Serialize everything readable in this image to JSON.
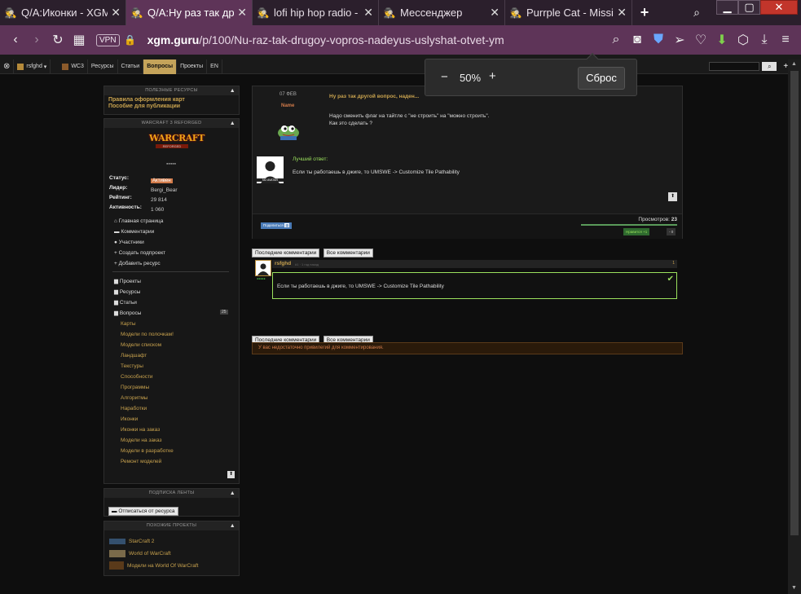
{
  "browser": {
    "tabs": [
      {
        "label": "Q/A:Иконки - XGM",
        "icon": "spy-icon",
        "active": false
      },
      {
        "label": "Q/A:Ну раз так другой",
        "icon": "spy-icon",
        "active": true
      },
      {
        "label": "lofi hip hop radio -",
        "icon": "spy-icon",
        "active": false
      },
      {
        "label": "Мессенджер",
        "icon": "spy-icon",
        "active": false
      },
      {
        "label": "Purrple Cat - Missin",
        "icon": "spy-icon",
        "active": false
      }
    ],
    "vpn": "VPN",
    "url_host": "xgm.guru",
    "url_path": "/p/100/Nu-raz-tak-drugoy-vopros-nadeyus-uslyshat-otvet-ym",
    "zoom": {
      "value": "50%",
      "minus": "−",
      "plus": "+",
      "reset": "Сброс"
    }
  },
  "site": {
    "user": "rsfghd",
    "nav": [
      "WC3",
      "Ресурсы",
      "Статьи",
      "Вопросы",
      "Проекты",
      "EN"
    ],
    "nav_active": "Вопросы"
  },
  "sidebar": {
    "useful": {
      "title": "ПОЛЕЗНЫЕ РЕСУРСЫ",
      "links": [
        "Правила оформления карт",
        "Пособие для публикации"
      ]
    },
    "project": {
      "title": "WARCRAFT 3 REFORGED",
      "logo": "WARCRAFT",
      "logo_sub": "REFORGED",
      "stars": "●●●●●",
      "status_label": "Статус:",
      "status": "Активен",
      "leader_label": "Лидер:",
      "leader": "Bergi_Bear",
      "rating_label": "Рейтинг:",
      "rating": "29 814",
      "activity_label": "Активность:",
      "activity": "1 060",
      "menu": [
        "Главная страница",
        "Комментарии",
        "Участники",
        "Создать подпроект",
        "Добавить ресурс"
      ],
      "sections": [
        "Проекты",
        "Ресурсы",
        "Статьи",
        "Вопросы"
      ],
      "questions_count": "25",
      "subs": [
        "Карты",
        "Модели по полочкам!",
        "Модели списком",
        "Ландшафт",
        "Текстуры",
        "Способности",
        "Программы",
        "Алгоритмы",
        "Наработки",
        "Иконки",
        "Иконки на заказ",
        "Модели на заказ",
        "Модели в разработке",
        "Ремонт моделей"
      ]
    },
    "subscription": {
      "title": "ПОДПИСКА ЛЕНТЫ",
      "button": "Отписаться от ресурса"
    },
    "similar": {
      "title": "ПОХОЖИЕ ПРОЕКТЫ",
      "items": [
        "StarCraft 2",
        "World of WarCraft",
        "Модели на World Of WarCraft"
      ]
    }
  },
  "question": {
    "date": "07 ФЕВ",
    "author_name": "Name",
    "title": "Ну раз так другой вопрос, наден...",
    "body_line1": "Надо сменить флаг на тайтле с \"не строить\" на \"можно строить\".",
    "body_line2": "Как это сделать ?",
    "best_label": "Лучший ответ:",
    "best_text": "Если ты работаешь в джиге, то UMSWE -> Customize Tile Pathability",
    "avatar_caption": "NO AVATAR",
    "share": "Поделиться",
    "views_label": "Просмотров:",
    "views": "23",
    "like": "Нравится +1",
    "dislike": "- 0"
  },
  "comments": {
    "tab_recent": "Последние комментарии",
    "tab_all": "Все комментарии",
    "author": "rsfghd",
    "meta": "#1 · 1 год назад",
    "num": "1",
    "text": "Если ты работаешь в джиге, то UMSWE -> Customize Tile Pathability",
    "no_priv": "У вас недостаточно привилегий для комментирования."
  }
}
